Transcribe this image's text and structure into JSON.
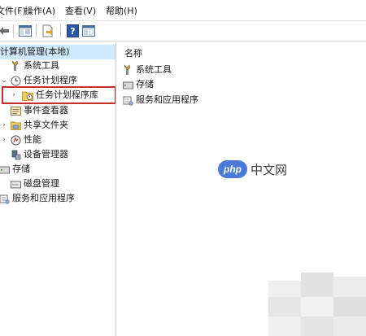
{
  "menu": {
    "file": "文件(F)",
    "action": "操作(A)",
    "view": "查看(V)",
    "help": "帮助(H)"
  },
  "toolbar": {
    "icons": [
      "back-arrow-icon",
      "forward-arrow-icon",
      "show-hide-tree-icon",
      "export-list-icon",
      "help-icon",
      "properties-icon"
    ]
  },
  "tree": {
    "root": "计算机管理(本地)",
    "system_tools": "系统工具",
    "task_scheduler": "任务计划程序",
    "task_scheduler_library": "任务计划程序库",
    "event_viewer": "事件查看器",
    "shared_folders": "共享文件夹",
    "performance": "性能",
    "device_manager": "设备管理器",
    "storage": "存储",
    "disk_management": "磁盘管理",
    "services_apps": "服务和应用程序"
  },
  "list": {
    "column_name": "名称",
    "items": [
      "系统工具",
      "存储",
      "服务和应用程序"
    ]
  },
  "watermark": {
    "badge": "php",
    "text": "中文网"
  },
  "colors": {
    "selection": "#cde8ff",
    "highlight_border": "#c9302c",
    "watermark_blue": "#4b7bd6"
  }
}
